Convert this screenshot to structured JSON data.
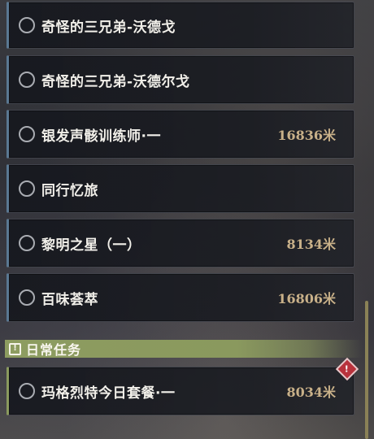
{
  "quests": [
    {
      "title": "奇怪的三兄弟-沃德戈",
      "distance": ""
    },
    {
      "title": "奇怪的三兄弟-沃德尔戈",
      "distance": ""
    },
    {
      "title": "银发声骸训练师·一",
      "distance": "16836米"
    },
    {
      "title": "同行忆旅",
      "distance": ""
    },
    {
      "title": "黎明之星（一）",
      "distance": "8134米"
    },
    {
      "title": "百味荟萃",
      "distance": "16806米"
    }
  ],
  "daily_section": {
    "label": "日常任务",
    "icon": "exclamation-box-icon",
    "quests": [
      {
        "title": "玛格烈特今日套餐·一",
        "distance": "8034米",
        "badge": "!"
      }
    ]
  },
  "colors": {
    "normal_accent": "#5a7892",
    "daily_accent": "#8a9a5e",
    "distance_text": "#c9b189",
    "badge_red": "#b8323c"
  }
}
